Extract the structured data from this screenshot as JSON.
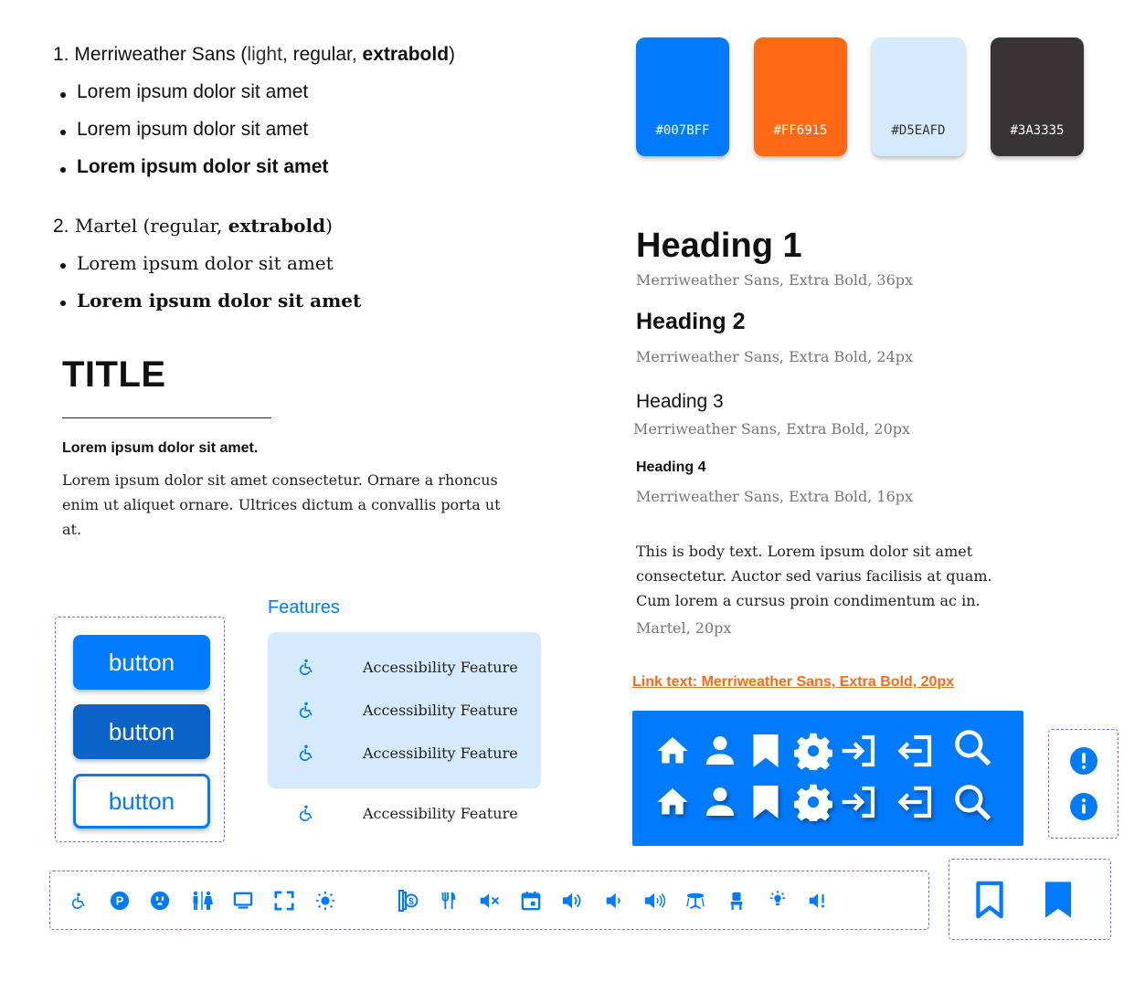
{
  "fonts": {
    "item1": {
      "num": "1.",
      "name": "Merriweather Sans (",
      "light": "light",
      "sep1": ", ",
      "regular": "regular",
      "sep2": ", ",
      "bold": "extrabold",
      "close": ")"
    },
    "item1_samples": [
      "Lorem ipsum dolor sit amet",
      "Lorem ipsum dolor sit amet",
      "Lorem ipsum dolor sit amet"
    ],
    "item2": {
      "num": "2.",
      "name": "Martel (",
      "regular": "regular",
      "sep": ", ",
      "bold": "extrabold",
      "close": ")"
    },
    "item2_samples": [
      "Lorem ipsum dolor sit amet",
      "Lorem ipsum dolor sit amet"
    ]
  },
  "title_block": {
    "title": "TITLE",
    "subtitle": "Lorem ipsum dolor sit amet.",
    "body": "Lorem ipsum dolor sit amet consectetur. Ornare a rhoncus enim ut aliquet ornare. Ultrices dictum a convallis porta ut at."
  },
  "swatches": [
    {
      "hex": "#007BFF",
      "label": "#007BFF"
    },
    {
      "hex": "#FF6915",
      "label": "#FF6915"
    },
    {
      "hex": "#D5EAFD",
      "label": "#D5EAFD"
    },
    {
      "hex": "#3A3335",
      "label": "#3A3335"
    }
  ],
  "headings": {
    "h1": "Heading 1",
    "h1_meta": "Merriweather Sans, Extra Bold, 36px",
    "h2": "Heading 2",
    "h2_meta": "Merriweather Sans, Extra Bold, 24px",
    "h3": "Heading 3",
    "h3_meta": "Merriweather Sans, Extra Bold, 20px",
    "h4": "Heading 4",
    "h4_meta": "Merriweather Sans, Extra Bold, 16px",
    "body": "This is body text. Lorem ipsum dolor sit amet consectetur. Auctor sed varius facilisis at quam. Cum lorem a cursus proin condimentum ac in.",
    "body_meta": "Martel, 20px",
    "link": "Link text: Merriweather Sans, Extra Bold, 20px"
  },
  "buttons": [
    "button",
    "button",
    "button"
  ],
  "features": {
    "heading": "Features",
    "items": [
      "Accessibility Feature",
      "Accessibility Feature",
      "Accessibility Feature"
    ],
    "standalone": "Accessibility Feature"
  },
  "colors": {
    "primary": "#007BFF",
    "primary_dark": "#0A63C9",
    "accent": "#FF6915",
    "light": "#D5EAFD",
    "dark": "#3A3335",
    "dash": "#9A5CCF"
  },
  "icon_panel": [
    "home-icon",
    "user-icon",
    "bookmark-icon",
    "gear-icon",
    "login-icon",
    "logout-icon",
    "search-icon"
  ],
  "status_icons": [
    "alert-icon",
    "info-icon"
  ],
  "icon_bar": [
    "wheelchair-icon",
    "parking-icon",
    "outlet-icon",
    "restroom-icon",
    "monitor-icon",
    "fullscreen-icon",
    "brightness-icon",
    "payment-icon",
    "restaurant-icon",
    "mute-icon",
    "calendar-icon",
    "volume-high-icon",
    "volume-low-icon",
    "volume-mid-icon",
    "table-icon",
    "chair-icon",
    "light-icon",
    "alert-volume-icon"
  ],
  "bookmark_icons": [
    "bookmark-outline-icon",
    "bookmark-filled-icon"
  ]
}
